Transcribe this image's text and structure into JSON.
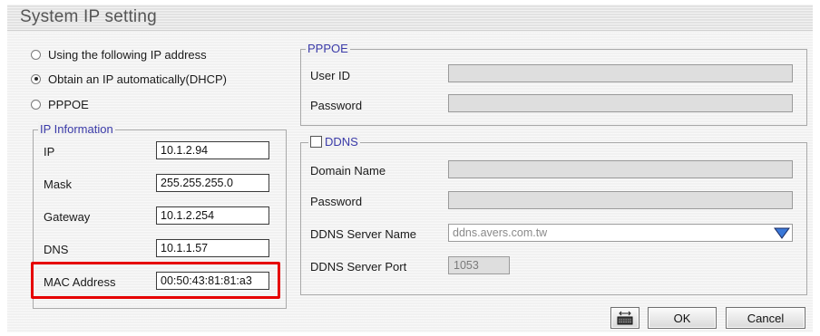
{
  "window": {
    "title": "System IP setting"
  },
  "ip_mode": {
    "options": [
      {
        "label": "Using the following IP address",
        "selected": false
      },
      {
        "label": "Obtain an IP automatically(DHCP)",
        "selected": true
      },
      {
        "label": "PPPOE",
        "selected": false
      }
    ]
  },
  "ip_info": {
    "legend": "IP Information",
    "ip_label": "IP",
    "ip_value": "10.1.2.94",
    "mask_label": "Mask",
    "mask_value": "255.255.255.0",
    "gateway_label": "Gateway",
    "gateway_value": "10.1.2.254",
    "dns_label": "DNS",
    "dns_value": "10.1.1.57",
    "mac_label": "MAC Address",
    "mac_value": "00:50:43:81:81:a3"
  },
  "pppoe": {
    "legend": "PPPOE",
    "user_id_label": "User ID",
    "user_id_value": "",
    "password_label": "Password",
    "password_value": ""
  },
  "ddns": {
    "legend": "DDNS",
    "enabled": false,
    "domain_label": "Domain Name",
    "domain_value": "",
    "password_label": "Password",
    "password_value": "",
    "server_name_label": "DDNS Server Name",
    "server_name_value": "ddns.avers.com.tw",
    "server_port_label": "DDNS Server Port",
    "server_port_value": "1053"
  },
  "buttons": {
    "ok": "OK",
    "cancel": "Cancel",
    "keyboard_icon": "keyboard-icon"
  },
  "colors": {
    "highlight": "#e60000",
    "legend": "#3a3aa8",
    "dropdown_arrow": "#3a78d8"
  }
}
